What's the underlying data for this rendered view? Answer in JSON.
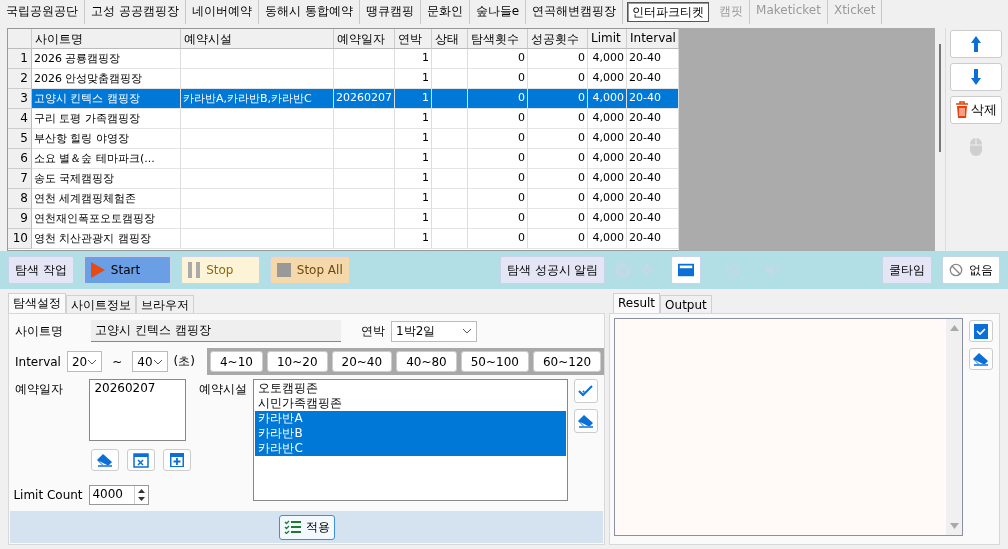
{
  "site_tabs": [
    {
      "label": "국립공원공단",
      "selected": false,
      "disabled": false
    },
    {
      "label": "고성 공공캠핑장",
      "selected": false,
      "disabled": false
    },
    {
      "label": "네이버예약",
      "selected": false,
      "disabled": false
    },
    {
      "label": "동해시 통합예약",
      "selected": false,
      "disabled": false
    },
    {
      "label": "땡큐캠핑",
      "selected": false,
      "disabled": false
    },
    {
      "label": "문화인",
      "selected": false,
      "disabled": false
    },
    {
      "label": "숲나들e",
      "selected": false,
      "disabled": false
    },
    {
      "label": "연곡해변캠핑장",
      "selected": false,
      "disabled": false
    },
    {
      "label": "인터파크티켓",
      "selected": true,
      "disabled": false
    },
    {
      "label": "캠핏",
      "selected": false,
      "disabled": true
    },
    {
      "label": "Maketicket",
      "selected": false,
      "disabled": true
    },
    {
      "label": "Xticket",
      "selected": false,
      "disabled": true
    }
  ],
  "table": {
    "columns": [
      "사이트명",
      "예약시설",
      "예약일자",
      "연박",
      "상태",
      "탐색횟수",
      "성공횟수",
      "Limit",
      "Interval"
    ],
    "rows": [
      {
        "number": "1",
        "selected": false,
        "cells": [
          "2026 공룡캠핑장",
          "",
          "",
          "1",
          "",
          "0",
          "0",
          "4,000",
          "20-40"
        ]
      },
      {
        "number": "2",
        "selected": false,
        "cells": [
          "2026 안성맞춤캠핑장",
          "",
          "",
          "1",
          "",
          "0",
          "0",
          "4,000",
          "20-40"
        ]
      },
      {
        "number": "3",
        "selected": true,
        "cells": [
          "고양시 킨텍스 캠핑장",
          "카라반A,카라반B,카라반C",
          "20260207",
          "1",
          "",
          "0",
          "0",
          "4,000",
          "20-40"
        ]
      },
      {
        "number": "4",
        "selected": false,
        "cells": [
          "구리 토평 가족캠핑장",
          "",
          "",
          "1",
          "",
          "0",
          "0",
          "4,000",
          "20-40"
        ]
      },
      {
        "number": "5",
        "selected": false,
        "cells": [
          "부산항 힐링 야영장",
          "",
          "",
          "1",
          "",
          "0",
          "0",
          "4,000",
          "20-40"
        ]
      },
      {
        "number": "6",
        "selected": false,
        "cells": [
          "소요 별＆숲 테마파크(...",
          "",
          "",
          "1",
          "",
          "0",
          "0",
          "4,000",
          "20-40"
        ]
      },
      {
        "number": "7",
        "selected": false,
        "cells": [
          "송도 국제캠핑장",
          "",
          "",
          "1",
          "",
          "0",
          "0",
          "4,000",
          "20-40"
        ]
      },
      {
        "number": "8",
        "selected": false,
        "cells": [
          "연천 세계캠핑체험존",
          "",
          "",
          "1",
          "",
          "0",
          "0",
          "4,000",
          "20-40"
        ]
      },
      {
        "number": "9",
        "selected": false,
        "cells": [
          "연천재인폭포오토캠핑장",
          "",
          "",
          "1",
          "",
          "0",
          "0",
          "4,000",
          "20-40"
        ]
      },
      {
        "number": "10",
        "selected": false,
        "cells": [
          "영천 치산관광지 캠핑장",
          "",
          "",
          "1",
          "",
          "0",
          "0",
          "4,000",
          "20-40"
        ]
      }
    ]
  },
  "side_buttons": {
    "delete": "삭제"
  },
  "toolbar": {
    "task_label": "탐색 작업",
    "start": "Start",
    "stop": "Stop",
    "stop_all": "Stop All",
    "alert_label": "탐색 성공시 알림",
    "cooltime_label": "쿨타임",
    "cooltime_value": "없음"
  },
  "settings_tabs": [
    {
      "label": "탐색설정",
      "selected": true
    },
    {
      "label": "사이트정보",
      "selected": false
    },
    {
      "label": "브라우저",
      "selected": false
    }
  ],
  "form": {
    "site_name_label": "사이트명",
    "site_name": "고양시 킨텍스 캠핑장",
    "nights_label": "연박",
    "nights": "1박2일",
    "interval_label": "Interval",
    "interval_from": "20",
    "interval_sep": "~",
    "interval_to": "40",
    "interval_unit": "(초)",
    "presets": [
      "4~10",
      "10~20",
      "20~40",
      "40~80",
      "50~100",
      "60~120"
    ],
    "date_label": "예약일자",
    "dates": [
      "20260207"
    ],
    "facility_label": "예약시설",
    "facilities": [
      {
        "label": "오토캠핑존",
        "selected": false
      },
      {
        "label": "시민가족캠핑존",
        "selected": false
      },
      {
        "label": "카라반A",
        "selected": true
      },
      {
        "label": "카라반B",
        "selected": true
      },
      {
        "label": "카라반C",
        "selected": true
      }
    ],
    "limit_label": "Limit Count",
    "limit": "4000",
    "apply": "적용"
  },
  "result_tabs": [
    {
      "label": "Result",
      "selected": true
    },
    {
      "label": "Output",
      "selected": false
    }
  ]
}
